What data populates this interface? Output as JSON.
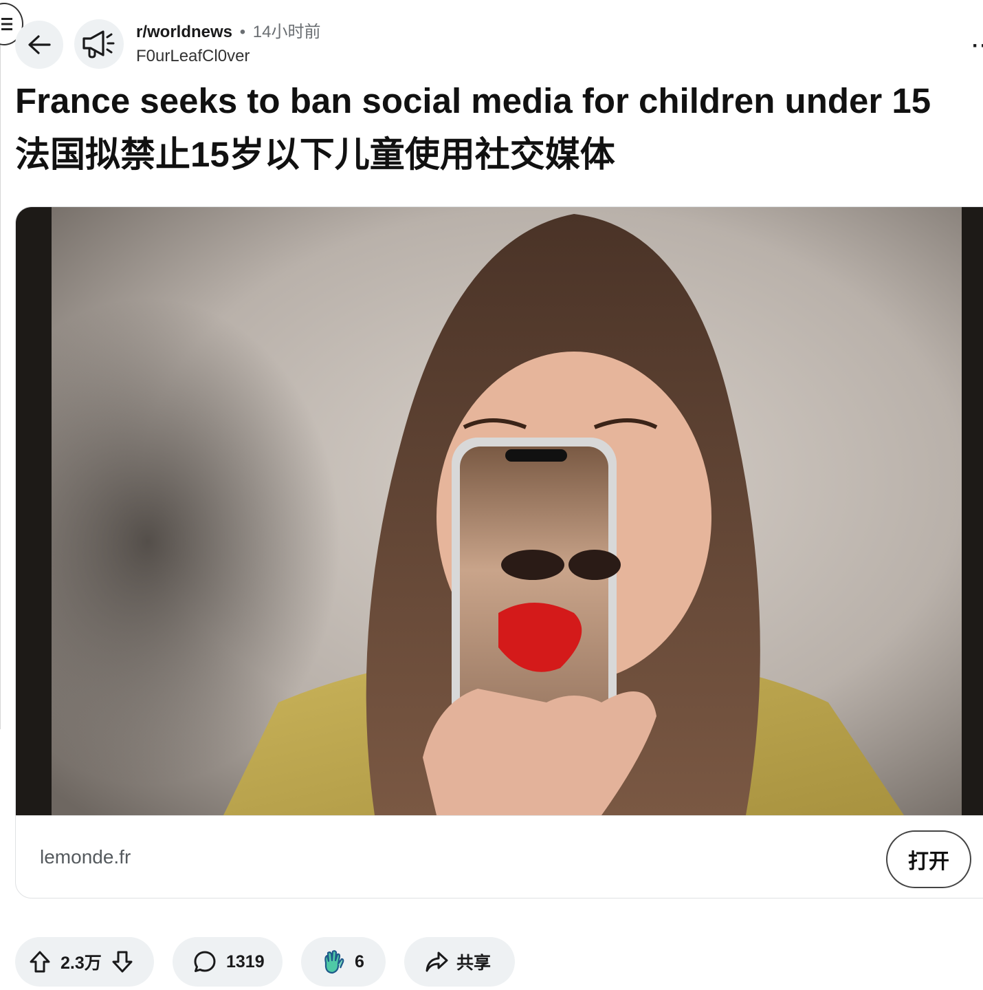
{
  "post": {
    "subreddit": "r/worldnews",
    "separator": "•",
    "time_ago": "14小时前",
    "author": "F0urLeafCl0ver",
    "title_en": "France seeks to ban social media for children under 15",
    "title_zh": "法国拟禁止15岁以下儿童使用社交媒体"
  },
  "link": {
    "domain": "lemonde.fr",
    "open_label": "打开"
  },
  "actions": {
    "score": "2.3万",
    "comments": "1319",
    "awards": "6",
    "share_label": "共享"
  },
  "more_label": "··"
}
